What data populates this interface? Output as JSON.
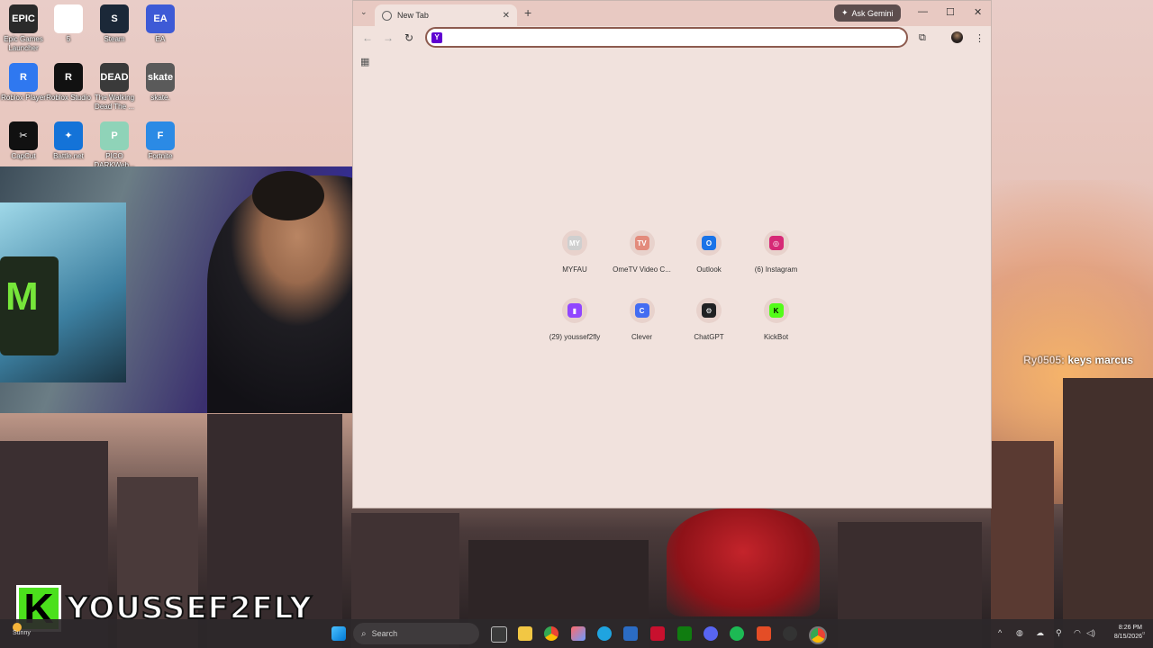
{
  "desktop": {
    "icons": [
      {
        "label": "Epic Games Launcher",
        "glyph": "EPIC",
        "color": "#2a2a2a"
      },
      {
        "label": "5",
        "glyph": "",
        "color": "#ffffff"
      },
      {
        "label": "Steam",
        "glyph": "S",
        "color": "#1b2838"
      },
      {
        "label": "EA",
        "glyph": "EA",
        "color": "#3d5ad6"
      },
      {
        "label": "Roblox Player",
        "glyph": "R",
        "color": "#2f78f0"
      },
      {
        "label": "Roblox Studio",
        "glyph": "R",
        "color": "#111111"
      },
      {
        "label": "The Walking Dead The ...",
        "glyph": "DEAD",
        "color": "#3a3a3a"
      },
      {
        "label": "skate.",
        "glyph": "skate",
        "color": "#5a5a5a"
      },
      {
        "label": "CapCut",
        "glyph": "✂",
        "color": "#111111"
      },
      {
        "label": "Battle.net",
        "glyph": "✦",
        "color": "#1473d8"
      },
      {
        "label": "PICO DARKWeb...",
        "glyph": "P",
        "color": "#8fd3b8"
      },
      {
        "label": "Fortnite",
        "glyph": "F",
        "color": "#2b8ae5"
      }
    ]
  },
  "browser": {
    "tab_title": "New Tab",
    "ask_gemini": "Ask Gemini",
    "address_value": "",
    "shortcuts": [
      {
        "name": "MYFAU",
        "glyph": "MY",
        "color": "#cfcfcf"
      },
      {
        "name": "OmeTV Video C...",
        "glyph": "TV",
        "color": "#e38b7c"
      },
      {
        "name": "Outlook",
        "glyph": "O",
        "color": "#1a73e8"
      },
      {
        "name": "(6) Instagram",
        "glyph": "◎",
        "color": "#d62976"
      },
      {
        "name": "(29) youssef2fly",
        "glyph": "▮",
        "color": "#9146ff"
      },
      {
        "name": "Clever",
        "glyph": "C",
        "color": "#436cf2"
      },
      {
        "name": "ChatGPT",
        "glyph": "⚙",
        "color": "#202123"
      },
      {
        "name": "KickBot",
        "glyph": "K",
        "color": "#53fc18"
      }
    ]
  },
  "chat_overlay": {
    "user": "Ry0505:",
    "message": " keys marcus"
  },
  "brand": {
    "logo_letter": "K",
    "name": "YOUSSEF2FLY"
  },
  "taskbar": {
    "weather": "Sunny",
    "search_placeholder": "Search",
    "time": "8:26 PM",
    "date": "8/15/2026"
  }
}
